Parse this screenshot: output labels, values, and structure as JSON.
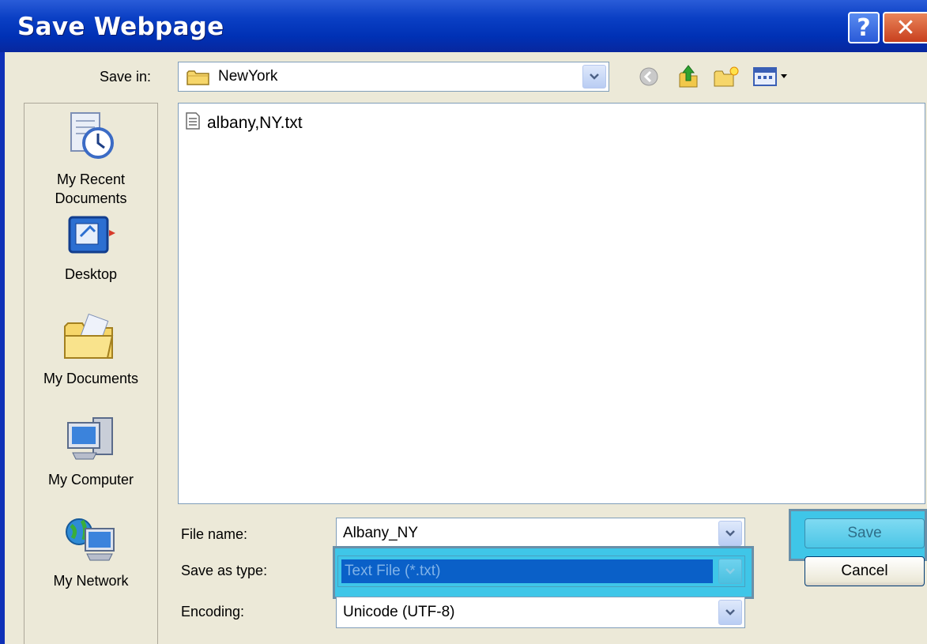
{
  "window": {
    "title": "Save Webpage",
    "help_label": "?",
    "close_label": "✕"
  },
  "save_in": {
    "label": "Save in:",
    "value": "NewYork"
  },
  "toolbar": {
    "icons": [
      "back-icon",
      "up-folder-icon",
      "new-folder-icon",
      "views-menu-icon"
    ]
  },
  "places": [
    {
      "label_line1": "My Recent",
      "label_line2": "Documents"
    },
    {
      "label_line1": "Desktop",
      "label_line2": ""
    },
    {
      "label_line1": "My Documents",
      "label_line2": ""
    },
    {
      "label_line1": "My Computer",
      "label_line2": ""
    },
    {
      "label_line1": "My Network",
      "label_line2": ""
    }
  ],
  "files": [
    {
      "name": "albany,NY.txt"
    }
  ],
  "form": {
    "file_name_label": "File name:",
    "file_name_value": "Albany_NY",
    "save_as_type_label": "Save as type:",
    "save_as_type_value": "Text File (*.txt)",
    "encoding_label": "Encoding:",
    "encoding_value": "Unicode (UTF-8)"
  },
  "buttons": {
    "save": "Save",
    "cancel": "Cancel"
  },
  "colors": {
    "titlebar": "#0031b5",
    "dialog_bg": "#ece9d8",
    "highlight": "#3fc6e8",
    "selected_type_bg": "#0a60c8"
  }
}
